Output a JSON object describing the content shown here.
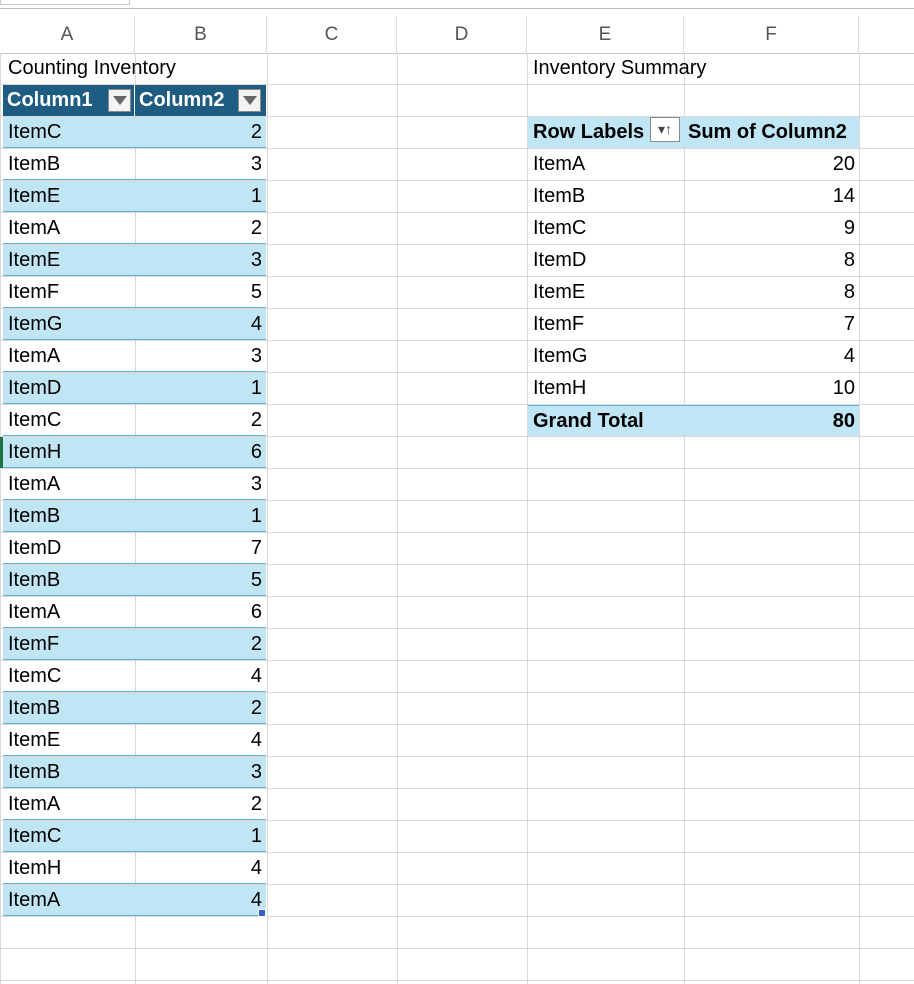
{
  "columns": [
    "A",
    "B",
    "C",
    "D",
    "E",
    "F"
  ],
  "table": {
    "title": "Counting Inventory",
    "headers": [
      "Column1",
      "Column2"
    ],
    "rows": [
      [
        "ItemC",
        "2"
      ],
      [
        "ItemB",
        "3"
      ],
      [
        "ItemE",
        "1"
      ],
      [
        "ItemA",
        "2"
      ],
      [
        "ItemE",
        "3"
      ],
      [
        "ItemF",
        "5"
      ],
      [
        "ItemG",
        "4"
      ],
      [
        "ItemA",
        "3"
      ],
      [
        "ItemD",
        "1"
      ],
      [
        "ItemC",
        "2"
      ],
      [
        "ItemH",
        "6"
      ],
      [
        "ItemA",
        "3"
      ],
      [
        "ItemB",
        "1"
      ],
      [
        "ItemD",
        "7"
      ],
      [
        "ItemB",
        "5"
      ],
      [
        "ItemA",
        "6"
      ],
      [
        "ItemF",
        "2"
      ],
      [
        "ItemC",
        "4"
      ],
      [
        "ItemB",
        "2"
      ],
      [
        "ItemE",
        "4"
      ],
      [
        "ItemB",
        "3"
      ],
      [
        "ItemA",
        "2"
      ],
      [
        "ItemC",
        "1"
      ],
      [
        "ItemH",
        "4"
      ],
      [
        "ItemA",
        "4"
      ]
    ]
  },
  "pivot": {
    "title": "Inventory Summary",
    "row_labels_header": "Row Labels",
    "sum_header": "Sum of Column2",
    "sort_icon_glyph": "▾↑",
    "rows": [
      [
        "ItemA",
        "20"
      ],
      [
        "ItemB",
        "14"
      ],
      [
        "ItemC",
        "9"
      ],
      [
        "ItemD",
        "8"
      ],
      [
        "ItemE",
        "8"
      ],
      [
        "ItemF",
        "7"
      ],
      [
        "ItemG",
        "4"
      ],
      [
        "ItemH",
        "10"
      ]
    ],
    "grand_total_label": "Grand Total",
    "grand_total_value": "80"
  },
  "colors": {
    "table_header": "#1f5c82",
    "band": "#c0e6f5",
    "band_border": "#5fb3e0"
  }
}
